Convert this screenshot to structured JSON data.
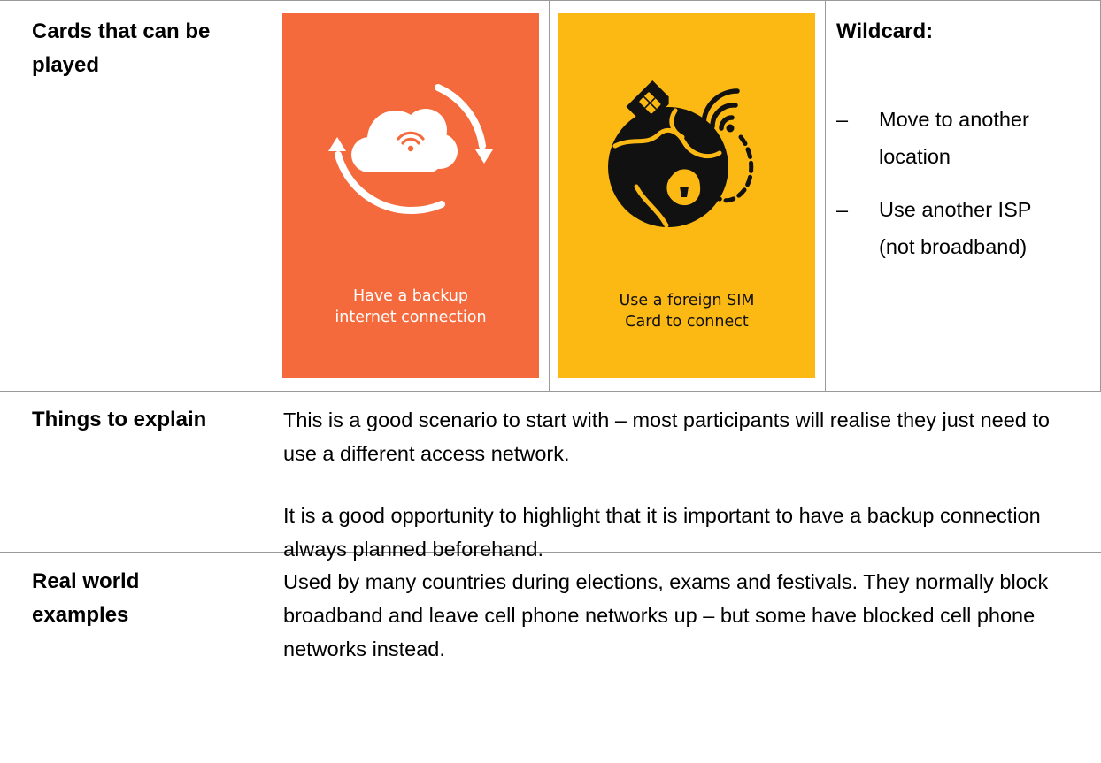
{
  "rows": {
    "cards": {
      "label": "Cards that can be played"
    },
    "explain": {
      "label": "Things to explain",
      "para1": "This is a good scenario to start with – most participants will realise they just need to use a different access network.",
      "para2": "It is a good opportunity to highlight that it is important to have a backup connection always planned beforehand."
    },
    "examples": {
      "label": "Real world examples",
      "text": "Used by many countries during elections, exams and festivals. They normally block broadband and leave cell phone networks up – but some have blocked cell phone networks instead."
    }
  },
  "card1": {
    "line1": "Have a backup",
    "line2": "internet connection",
    "color": "#F46A3C",
    "icon": "cloud-sync-wifi-icon"
  },
  "card2": {
    "line1": "Use a foreign SIM",
    "line2": "Card to connect",
    "color": "#FDB913",
    "icon": "globe-sim-wifi-icon",
    "sim_text": "SIM"
  },
  "wildcard": {
    "title": "Wildcard:",
    "dash": "–",
    "items": [
      {
        "line1": "Move to another",
        "line2": "location"
      },
      {
        "line1": "Use another ISP",
        "line2": "(not broadband)"
      }
    ]
  }
}
